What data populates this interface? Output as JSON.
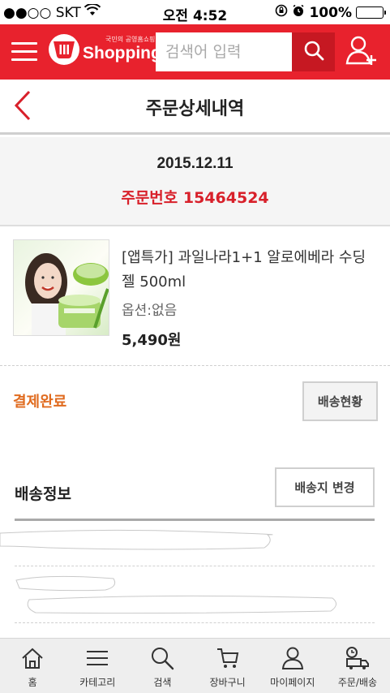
{
  "status_bar": {
    "carrier": "●●○○ SKT",
    "time": "오전 4:52",
    "battery": "100%"
  },
  "header": {
    "logo_subtitle": "국민의 공영홈쇼핑",
    "logo_text": "Shopping",
    "search_placeholder": "검색어 입력",
    "accent_color": "#e8222d"
  },
  "page": {
    "title": "주문상세내역"
  },
  "order": {
    "date": "2015.12.11",
    "order_number_label": "주문번호",
    "order_number": "15464524"
  },
  "product": {
    "name": "[앱특가] 과일나라1+1 알로에베라 수딩젤 500ml",
    "option": "옵션:없음",
    "price": "5,490원"
  },
  "payment": {
    "status": "결제완료",
    "delivery_status_button": "배송현황"
  },
  "shipping": {
    "title": "배송정보",
    "change_address_button": "배송지 변경"
  },
  "bottom_nav": {
    "items": [
      {
        "label": "홈",
        "icon": "home-icon"
      },
      {
        "label": "카테고리",
        "icon": "menu-icon"
      },
      {
        "label": "검색",
        "icon": "search-icon"
      },
      {
        "label": "장바구니",
        "icon": "cart-icon"
      },
      {
        "label": "마이페이지",
        "icon": "user-icon"
      },
      {
        "label": "주문/배송",
        "icon": "delivery-icon"
      }
    ]
  }
}
